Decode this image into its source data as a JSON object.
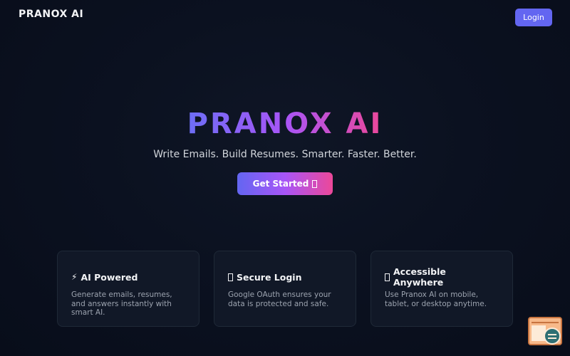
{
  "header": {
    "brand": "PRANOX AI",
    "login_label": "Login"
  },
  "hero": {
    "title": "PRANOX AI",
    "tagline": "Write Emails. Build Resumes. Smarter. Faster. Better.",
    "cta_label": "Get Started"
  },
  "features": [
    {
      "icon": "lightning-icon",
      "title": "AI Powered",
      "description": "Generate emails, resumes, and answers instantly with smart AI."
    },
    {
      "icon": "lock-icon",
      "title": "Secure Login",
      "description": "Google OAuth ensures your data is protected and safe."
    },
    {
      "icon": "globe-icon",
      "title": "Accessible Anywhere",
      "description": "Use Pranox AI on mobile, tablet, or desktop anytime."
    }
  ],
  "widget": {
    "icon": "code-inspector-icon"
  },
  "colors": {
    "background": "#0b1120",
    "accent": "#6366f1",
    "gradient_start": "#6366f1",
    "gradient_mid": "#a855f7",
    "gradient_end": "#ec4899",
    "card_bg": "#111827"
  }
}
